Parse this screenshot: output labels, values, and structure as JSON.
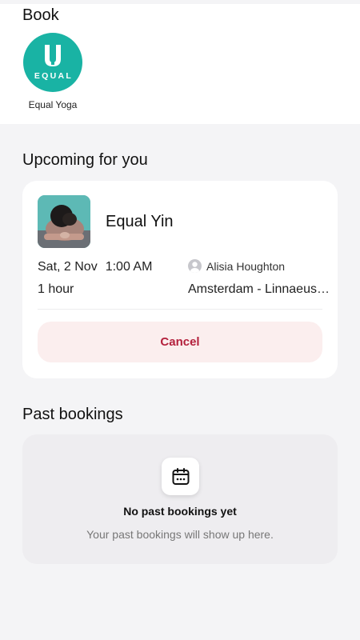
{
  "book": {
    "title": "Book",
    "studio": {
      "logo_text": "EQUAL",
      "name": "Equal Yoga",
      "logo_color": "#19b3a4"
    }
  },
  "upcoming": {
    "title": "Upcoming for you",
    "booking": {
      "class_name": "Equal Yin",
      "date": "Sat, 2 Nov",
      "time": "1:00 AM",
      "duration": "1 hour",
      "instructor": "Alisia Houghton",
      "location": "Amsterdam - Linnaeusstraat",
      "cancel_label": "Cancel"
    }
  },
  "past": {
    "title": "Past bookings",
    "empty_title": "No past bookings yet",
    "empty_subtitle": "Your past bookings will show up here."
  },
  "colors": {
    "accent_teal": "#19b3a4",
    "cancel_text": "#b3203c",
    "cancel_bg": "#fbeeee"
  }
}
